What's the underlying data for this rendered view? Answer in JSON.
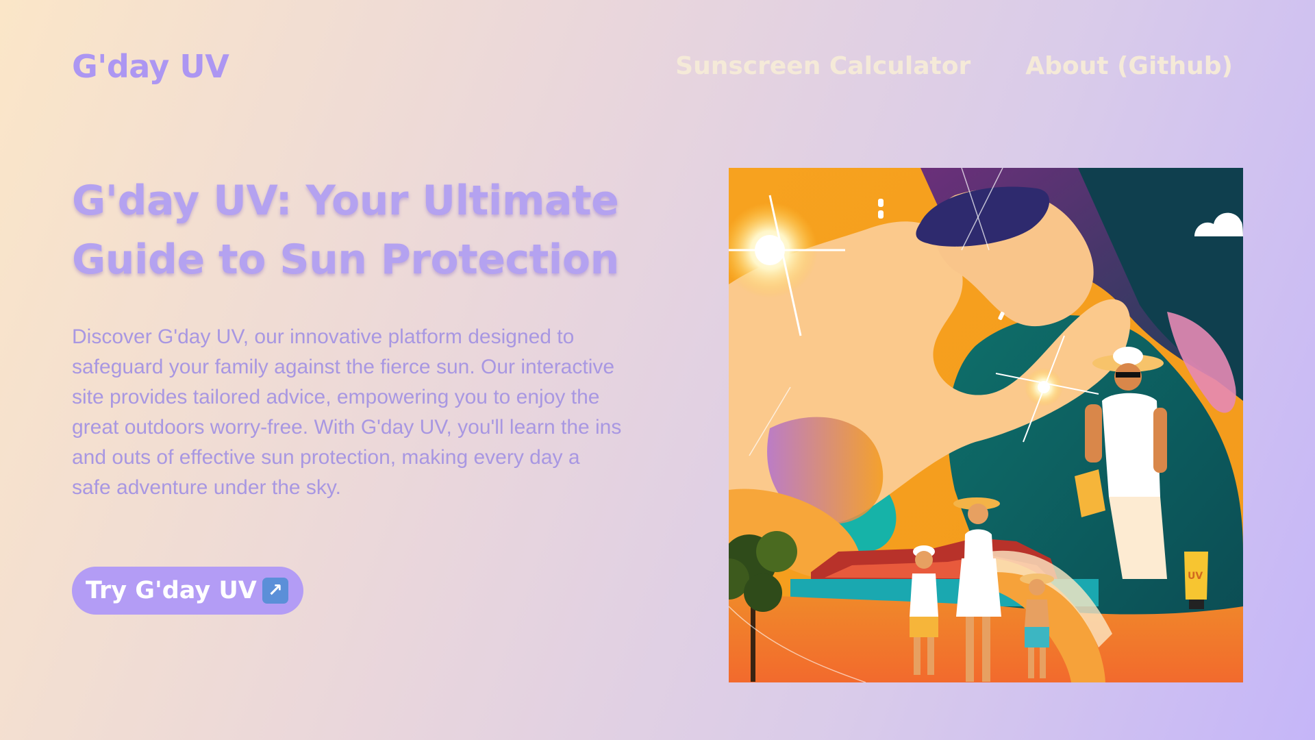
{
  "header": {
    "logo": "G'day UV",
    "nav": [
      {
        "label": "Sunscreen Calculator"
      },
      {
        "label": "About (Github)"
      }
    ]
  },
  "hero": {
    "title": "G'day UV: Your Ultimate Guide to Sun Protection",
    "description": "Discover G'day UV, our innovative platform designed to safeguard your family against the fierce sun. Our interactive site provides tailored advice, empowering you to enjoy the great outdoors worry-free. With G'day UV, you'll learn the ins and outs of effective sun protection, making every day a safe adventure under the sky.",
    "cta": {
      "label": "Try G'day UV",
      "icon": "arrow-up-right-icon",
      "glyph": "↗"
    }
  },
  "colors": {
    "accent": "#b39cf5",
    "logo": "#ac96f2",
    "nav_text": "#f5ead8",
    "title": "#b4a2f0",
    "body_text": "#a897e2"
  },
  "illustration": {
    "subject": "family-sun-protection-illustration"
  }
}
